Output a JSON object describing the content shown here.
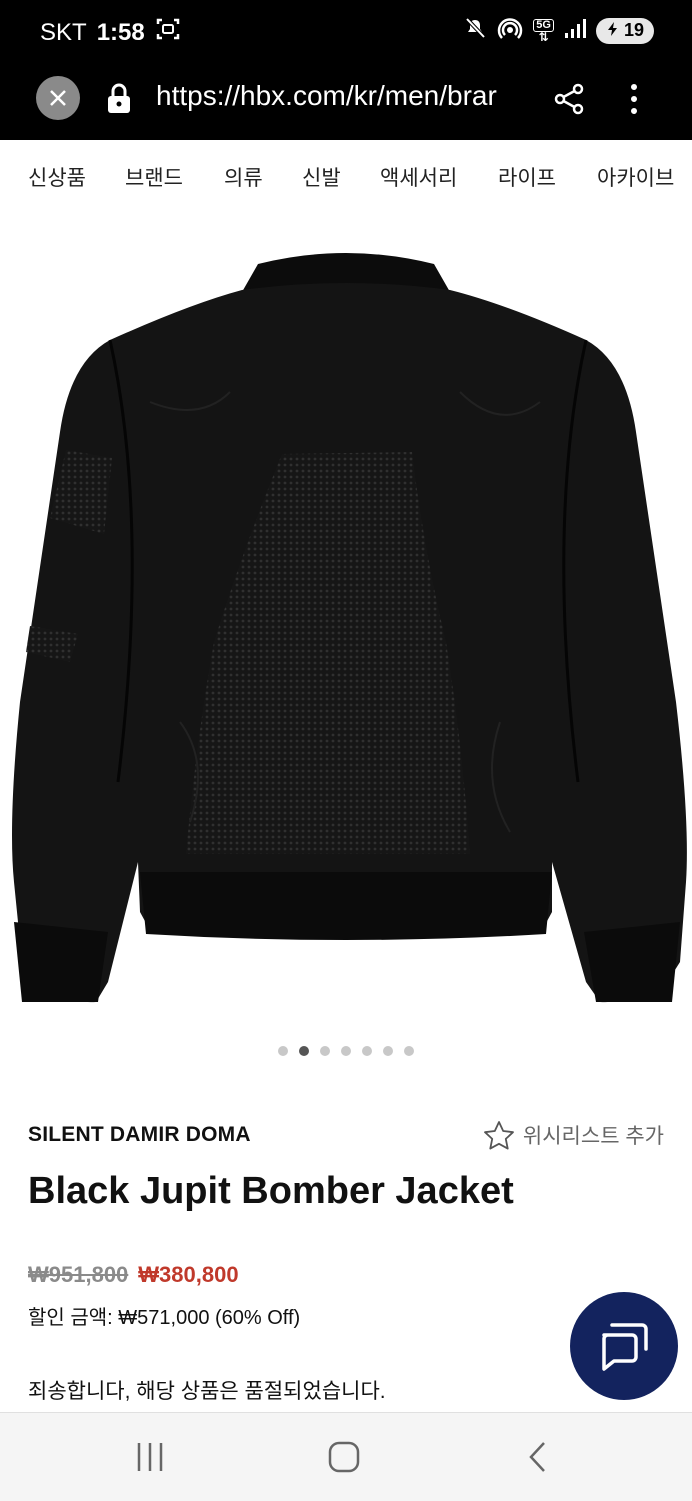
{
  "status": {
    "carrier": "SKT",
    "time": "1:58",
    "network": "5G",
    "battery": "19"
  },
  "browser": {
    "url": "https://hbx.com/kr/men/brar"
  },
  "categories": [
    "신상품",
    "브랜드",
    "의류",
    "신발",
    "액세서리",
    "라이프",
    "아카이브"
  ],
  "gallery": {
    "dot_count": 7,
    "active_index": 1
  },
  "product": {
    "brand": "SILENT DAMIR DOMA",
    "wishlist_label": "위시리스트 추가",
    "title": "Black Jupit Bomber Jacket",
    "original_price": "₩951,800",
    "sale_price": "₩380,800",
    "discount_text": "할인 금액: ₩571,000 (60% Off)",
    "sold_out_text": "죄송합니다, 해당 상품은 품절되었습니다."
  },
  "colors": {
    "sale": "#c0392b",
    "chat_button": "#13235e",
    "bar": "#000000"
  }
}
